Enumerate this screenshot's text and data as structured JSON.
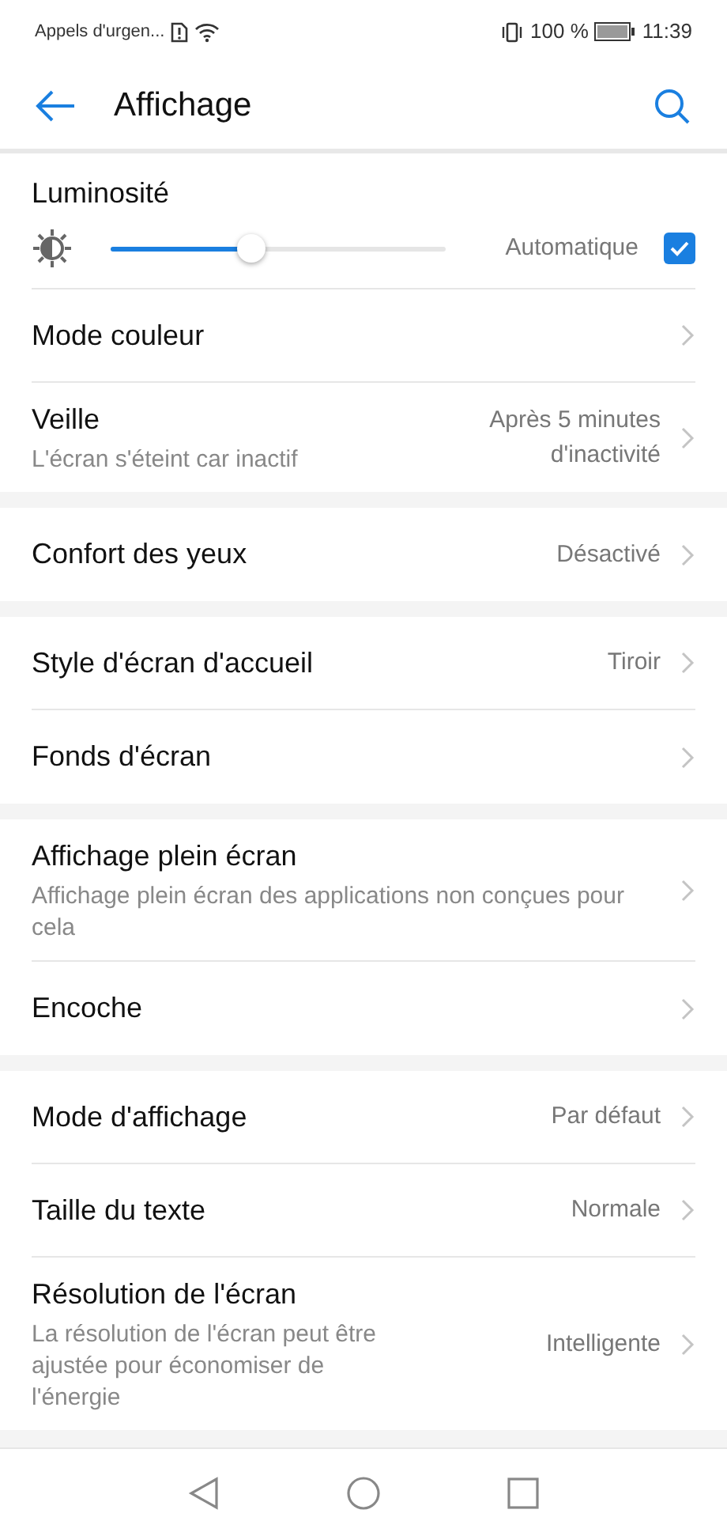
{
  "status_bar": {
    "carrier": "Appels d'urgen...",
    "battery": "100 %",
    "time": "11:39"
  },
  "header": {
    "title": "Affichage"
  },
  "sections": [
    {
      "items": [
        {
          "kind": "slider",
          "title": "Luminosité",
          "level": 0.42,
          "auto_label": "Automatique",
          "checked": true
        },
        {
          "kind": "link",
          "title": "Mode couleur"
        },
        {
          "kind": "link",
          "title": "Veille",
          "subtitle": "L'écran s'éteint car inactif",
          "value": "Après 5 minutes d'inactivité"
        }
      ]
    },
    {
      "items": [
        {
          "kind": "link",
          "title": "Confort des yeux",
          "value": "Désactivé"
        }
      ]
    },
    {
      "items": [
        {
          "kind": "link",
          "title": "Style d'écran d'accueil",
          "value": "Tiroir"
        },
        {
          "kind": "link",
          "title": "Fonds d'écran"
        }
      ]
    },
    {
      "items": [
        {
          "kind": "link",
          "title": "Affichage plein écran",
          "subtitle": "Affichage plein écran des applications non conçues pour cela"
        },
        {
          "kind": "link",
          "title": "Encoche"
        }
      ]
    },
    {
      "items": [
        {
          "kind": "link",
          "title": "Mode d'affichage",
          "value": "Par défaut"
        },
        {
          "kind": "link",
          "title": "Taille du texte",
          "value": "Normale"
        },
        {
          "kind": "link",
          "title": "Résolution de l'écran",
          "subtitle": "La résolution de l'écran peut être ajustée pour économiser de l'énergie",
          "value": "Intelligente"
        }
      ]
    }
  ]
}
